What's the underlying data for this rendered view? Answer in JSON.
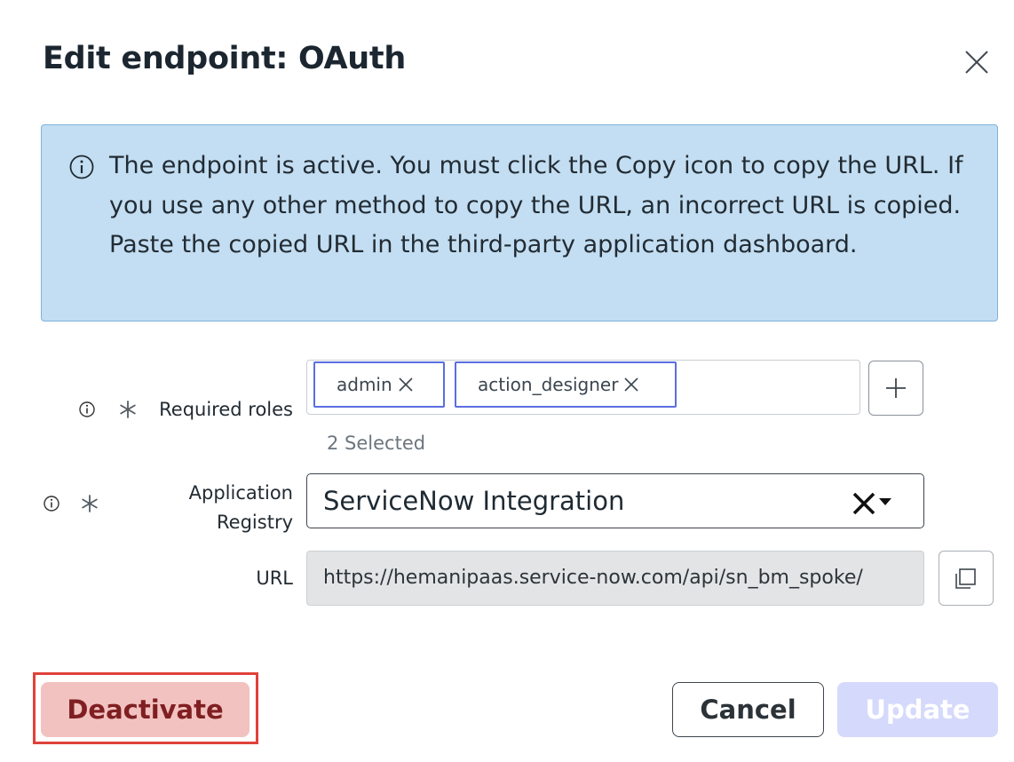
{
  "dialog": {
    "title": "Edit endpoint: OAuth"
  },
  "banner": {
    "message": "The endpoint is active. You must click the Copy icon to copy the URL. If you use any other method to copy the URL, an incorrect URL is copied. Paste the copied URL in the third-party application dashboard."
  },
  "form": {
    "required_roles": {
      "label": "Required roles",
      "chips": [
        "admin",
        "action_designer"
      ],
      "selected_count": "2 Selected"
    },
    "application_registry": {
      "label_line1": "Application",
      "label_line2": "Registry",
      "value": "ServiceNow Integration"
    },
    "url": {
      "label": "URL",
      "value": "https://hemanipaas.service-now.com/api/sn_bm_spoke/"
    }
  },
  "footer": {
    "deactivate_label": "Deactivate",
    "cancel_label": "Cancel",
    "update_label": "Update"
  },
  "colors": {
    "banner_bg": "#c3def2",
    "chip_border": "#5b6ee1",
    "deactivate_bg": "#f2c2c0",
    "update_bg_disabled": "#d5d9fb",
    "highlight": "#e0413a"
  }
}
